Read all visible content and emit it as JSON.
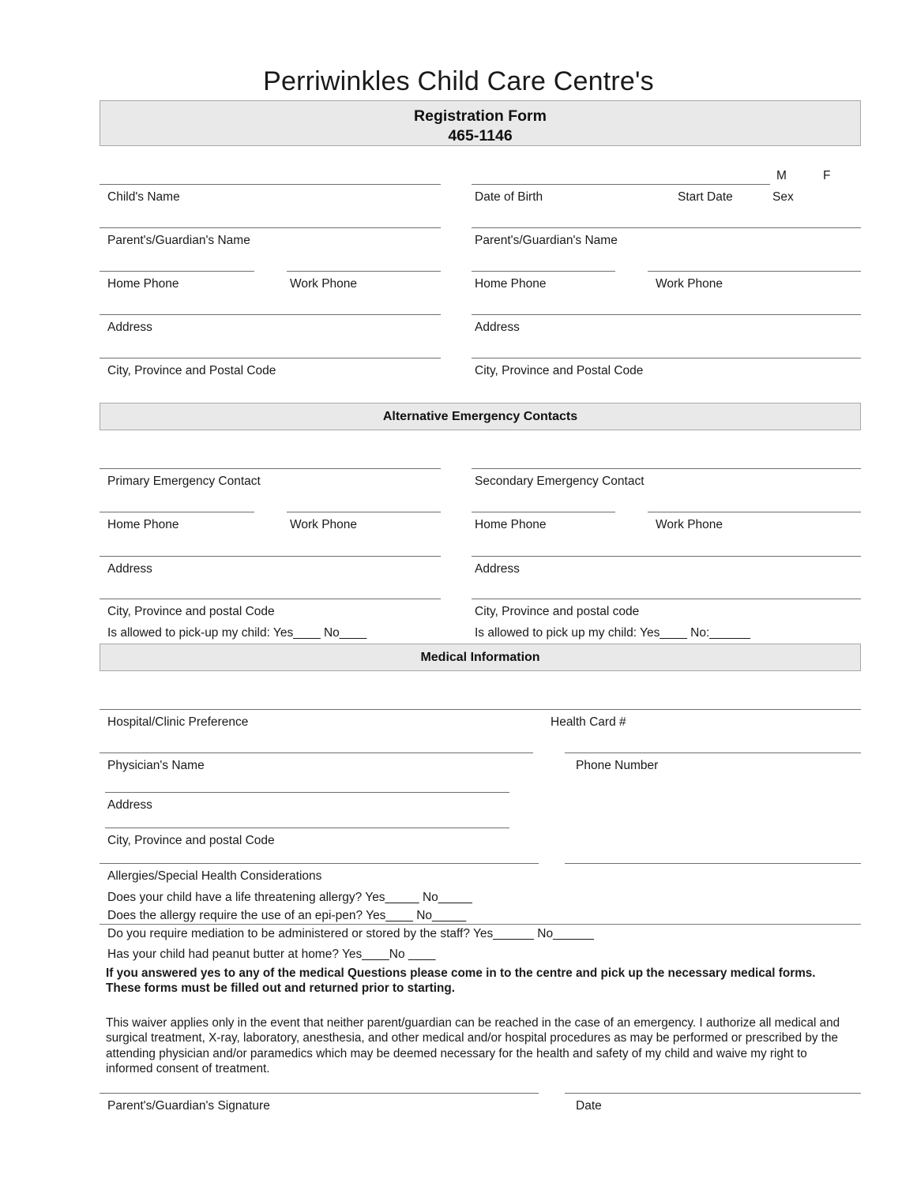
{
  "document": {
    "title": "Perriwinkles Child Care Centre's",
    "header": {
      "form_name": "Registration Form",
      "phone": "465-1146"
    }
  },
  "sections": {
    "child_info": {
      "child_name": "Child's Name",
      "date_of_birth": "Date of Birth",
      "start_date": "Start Date",
      "sex": "Sex",
      "sex_male": "M",
      "sex_female": "F",
      "parent1_name": "Parent's/Guardian's Name",
      "parent2_name": "Parent's/Guardian's Name",
      "parent1_home_phone": "Home Phone",
      "parent1_work_phone": "Work Phone",
      "parent2_home_phone": "Home Phone",
      "parent2_work_phone": "Work Phone",
      "parent1_address": "Address",
      "parent2_address": "Address",
      "parent1_city": "City, Province and Postal Code",
      "parent2_city": "City, Province and Postal Code"
    },
    "emergency": {
      "banner": "Alternative Emergency Contacts",
      "primary_contact": "Primary Emergency Contact",
      "secondary_contact": "Secondary Emergency Contact",
      "primary_home_phone": "Home Phone",
      "primary_work_phone": "Work Phone",
      "secondary_home_phone": "Home Phone",
      "secondary_work_phone": "Work Phone",
      "primary_address": "Address",
      "secondary_address": "Address",
      "primary_city": "City, Province and postal  Code",
      "secondary_city": "City, Province and postal code",
      "primary_pickup": "Is allowed to pick-up my child:   Yes____   No____",
      "secondary_pickup": "Is allowed to pick up my child:     Yes____ No:______"
    },
    "medical": {
      "banner": "Medical Information",
      "hospital_preference": "Hospital/Clinic Preference",
      "health_card": "Health Card #",
      "physician_name": "Physician's Name",
      "phone_number": "Phone Number",
      "address": "Address",
      "city": "City, Province and postal  Code",
      "allergies": "Allergies/Special Health Considerations",
      "q_life_threatening": "Does your child have a life threatening allergy? Yes_____  No_____",
      "q_epipen": "Does the allergy require the use of an epi-pen? Yes____  No_____",
      "q_medication": "Do you require mediation to be administered or stored by the staff?         Yes______  No______",
      "q_peanut": "Has your child had peanut butter at home?    Yes____No ____",
      "notice": "If you answered yes to any of the medical Questions please come in to the centre and pick up the necessary medical forms. These forms must be filled out and returned prior to starting."
    },
    "waiver": {
      "text": "This waiver applies only in the event that neither parent/guardian can be reached in the case of an emergency. I authorize all medical and surgical treatment, X-ray, laboratory, anesthesia, and other medical and/or hospital procedures as may be performed or prescribed by the attending physician and/or paramedics which may be deemed necessary for the health and safety of my child and waive my right to informed consent of treatment.",
      "signature_label": "Parent's/Guardian's Signature",
      "date_label": "Date"
    }
  }
}
